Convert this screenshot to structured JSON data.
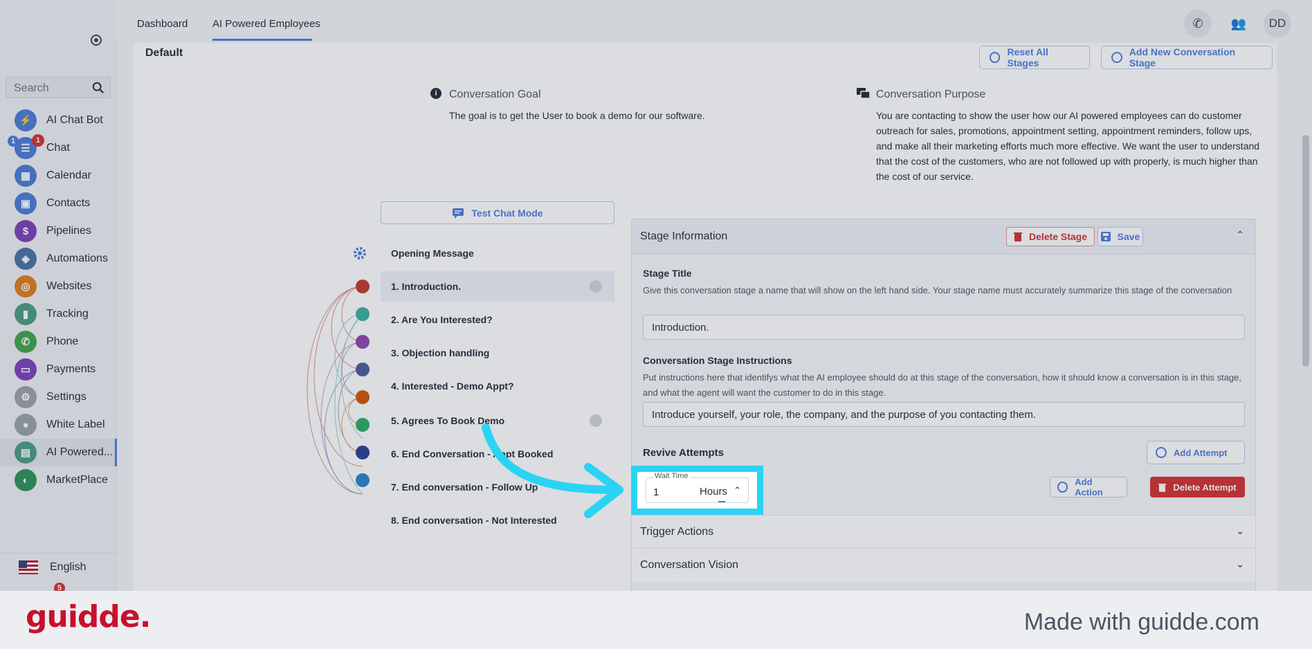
{
  "topbar": {
    "tabs": [
      "Dashboard",
      "AI Powered Employees"
    ],
    "avatar": "DD",
    "phone_icon": "phone-icon",
    "contacts_icon": "people-icon"
  },
  "sidebar": {
    "search_placeholder": "Search",
    "items": [
      {
        "label": "AI Chat Bot",
        "color": "#4a7bd6",
        "icon": "bolt-icon"
      },
      {
        "label": "Chat",
        "color": "#4a7bd6",
        "icon": "chat-icon",
        "badge_left": "1",
        "badge_right": "1"
      },
      {
        "label": "Calendar",
        "color": "#4a7bd6",
        "icon": "calendar-icon"
      },
      {
        "label": "Contacts",
        "color": "#4a7bd6",
        "icon": "contacts-icon"
      },
      {
        "label": "Pipelines",
        "color": "#7b3fb8",
        "icon": "dollar-icon"
      },
      {
        "label": "Automations",
        "color": "#4a6fa5",
        "icon": "automation-icon"
      },
      {
        "label": "Websites",
        "color": "#e07b1f",
        "icon": "globe-icon"
      },
      {
        "label": "Tracking",
        "color": "#4a9a82",
        "icon": "chart-icon"
      },
      {
        "label": "Phone",
        "color": "#3ea34a",
        "icon": "phone-icon"
      },
      {
        "label": "Payments",
        "color": "#7b3fb8",
        "icon": "card-icon"
      },
      {
        "label": "Settings",
        "color": "#9aa0a6",
        "icon": "gear-icon"
      },
      {
        "label": "White Label",
        "color": "#9aa0a6",
        "icon": "palette-icon"
      },
      {
        "label": "AI Powered...",
        "color": "#4a9a82",
        "icon": "robot-chat-icon"
      },
      {
        "label": "MarketPlace",
        "color": "#2f8f5a",
        "icon": "marketplace-icon"
      }
    ],
    "language": "English",
    "bottom_badge": "5"
  },
  "main": {
    "section_title": "Default",
    "reset_button": "Reset All Stages",
    "add_stage_button": "Add New Conversation Stage",
    "goal_title": "Conversation Goal",
    "goal_text": "The goal is to get the User to book a demo for our software.",
    "purpose_title": "Conversation Purpose",
    "purpose_text": "You are contacting to show the user how our AI powered employees can do customer outreach for sales, promotions, appointment setting, appointment reminders, follow ups, and make all their marketing efforts much more effective. We want the user to understand that the cost of the customers, who are not followed up with properly, is much higher than the cost of our service.",
    "test_chat_button": "Test Chat Mode",
    "opening_message": "Opening Message",
    "stages": [
      "1. Introduction.",
      "2. Are You Interested?",
      "3. Objection handling",
      "4. Interested - Demo Appt?",
      "5. Agrees To Book Demo",
      "6. End Conversation - Appt Booked",
      "7. End conversation - Follow Up",
      "8. End conversation - Not Interested"
    ],
    "stage_colors": [
      "#c0392b",
      "#3ab09e",
      "#8e44ad",
      "#4a5a9a",
      "#d35400",
      "#27ae60",
      "#2c3e8f",
      "#2f80c8"
    ]
  },
  "panel": {
    "title": "Stage Information",
    "delete_stage": "Delete Stage",
    "save": "Save",
    "stage_title_label": "Stage Title",
    "stage_title_help": "Give this conversation stage a name that will show on the left hand side. Your stage name must accurately summarize this stage of the conversation",
    "stage_title_value": "Introduction.",
    "instructions_label": "Conversation Stage Instructions",
    "instructions_help": "Put instructions here that identifys what the AI employee should do at this stage of the conversation, how it should know a conversation is in this stage, and what the agent will want the customer to do in this stage.",
    "instructions_value": "Introduce yourself, your role, the company, and the purpose of you contacting them.",
    "revive_label": "Revive Attempts",
    "add_attempt": "Add Attempt",
    "wait_time_label": "Wait Time",
    "wait_time_value": "1",
    "wait_unit": "Hours",
    "add_action": "Add Action",
    "delete_attempt": "Delete Attempt",
    "trigger_actions": "Trigger Actions",
    "conversation_vision": "Conversation Vision"
  },
  "footer": {
    "logo": "guidde.",
    "made_with": "Made with guidde.com"
  },
  "colors": {
    "accent": "#4f7be0",
    "danger": "#d32f2f",
    "highlight": "#2ad3f3",
    "brand": "#c8102e"
  }
}
